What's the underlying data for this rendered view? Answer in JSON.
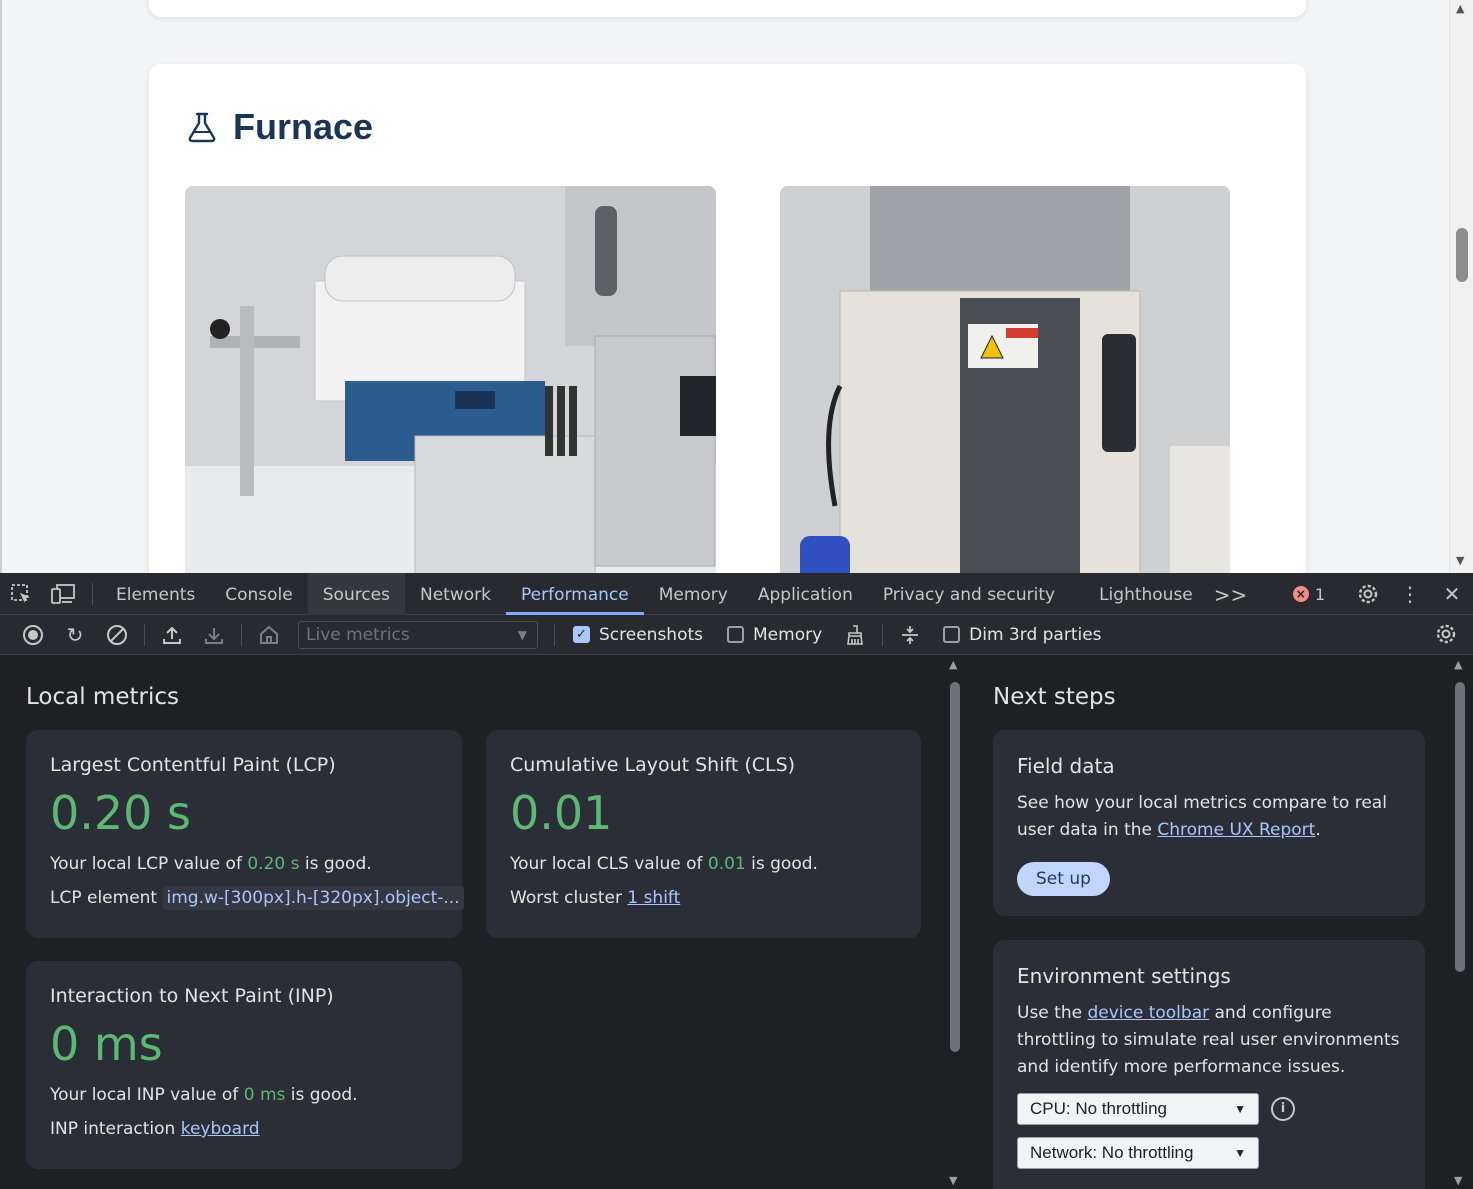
{
  "page": {
    "section_title": "Furnace"
  },
  "devtools": {
    "tabs": [
      "Elements",
      "Console",
      "Sources",
      "Network",
      "Performance",
      "Memory",
      "Application",
      "Privacy and security",
      "Lighthouse"
    ],
    "active_tab": "Performance",
    "hovered_tab": "Sources",
    "overflow_label": ">>",
    "error_count": "1",
    "toolbar": {
      "live_metrics_placeholder": "Live metrics",
      "screenshots_label": "Screenshots",
      "screenshots_checked": true,
      "memory_label": "Memory",
      "memory_checked": false,
      "dim_3rd_label": "Dim 3rd parties",
      "dim_3rd_checked": false
    },
    "local_metrics": {
      "title": "Local metrics",
      "lcp": {
        "title": "Largest Contentful Paint (LCP)",
        "value": "0.20 s",
        "desc_pre": "Your local LCP value of ",
        "desc_val": "0.20 s",
        "desc_post": " is good.",
        "element_label": "LCP element ",
        "element_value": "img.w-[300px].h-[320px].object-..."
      },
      "cls": {
        "title": "Cumulative Layout Shift (CLS)",
        "value": "0.01",
        "desc_pre": "Your local CLS value of ",
        "desc_val": "0.01",
        "desc_post": " is good.",
        "cluster_label": "Worst cluster ",
        "cluster_link": "1 shift"
      },
      "inp": {
        "title": "Interaction to Next Paint (INP)",
        "value": "0 ms",
        "desc_pre": "Your local INP value of ",
        "desc_val": "0 ms",
        "desc_post": " is good.",
        "interaction_label": "INP interaction ",
        "interaction_link": "keyboard"
      }
    },
    "next_steps": {
      "title": "Next steps",
      "field_data": {
        "title": "Field data",
        "text_pre": "See how your local metrics compare to real user data in the ",
        "link": "Chrome UX Report",
        "text_post": ".",
        "button": "Set up"
      },
      "environment": {
        "title": "Environment settings",
        "text_pre": "Use the ",
        "link": "device toolbar",
        "text_post": " and configure throttling to simulate real user environments and identify more performance issues.",
        "cpu": "CPU: No throttling",
        "network": "Network: No throttling"
      }
    },
    "colors": {
      "good": "#5bb974",
      "link": "#a8c7fa",
      "active_tab": "#7cacf8"
    }
  }
}
